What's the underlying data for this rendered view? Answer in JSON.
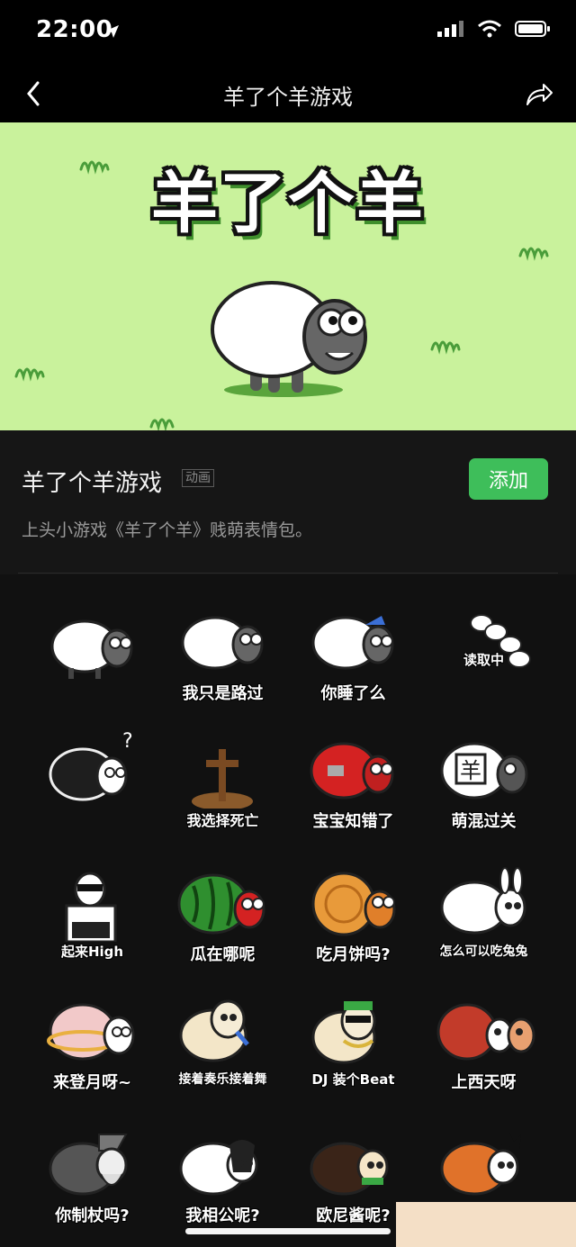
{
  "status": {
    "time": "22:00"
  },
  "nav": {
    "title": "羊了个羊游戏"
  },
  "banner": {
    "title": "羊了个羊"
  },
  "pack": {
    "title": "羊了个羊游戏",
    "tag": "动画",
    "add_label": "添加",
    "description": "上头小游戏《羊了个羊》贱萌表情包。"
  },
  "stickers": [
    {
      "caption": ""
    },
    {
      "caption": "我只是路过"
    },
    {
      "caption": "你睡了么"
    },
    {
      "caption": "读取中"
    },
    {
      "caption": ""
    },
    {
      "caption": "我选择死亡"
    },
    {
      "caption": "宝宝知错了"
    },
    {
      "caption": "萌混过关"
    },
    {
      "caption": "起来High"
    },
    {
      "caption": "瓜在哪呢"
    },
    {
      "caption": "吃月饼吗?"
    },
    {
      "caption": "怎么可以吃兔兔"
    },
    {
      "caption": "来登月呀~"
    },
    {
      "caption": "接着奏乐接着舞"
    },
    {
      "caption": "DJ 装个Beat"
    },
    {
      "caption": "上西天呀"
    },
    {
      "caption": "你制杖吗?"
    },
    {
      "caption": "我相公呢?"
    },
    {
      "caption": "欧尼酱呢?"
    },
    {
      "caption": ""
    }
  ],
  "colors": {
    "accent": "#3ebe5a",
    "banner_bg": "#c9f29c"
  }
}
